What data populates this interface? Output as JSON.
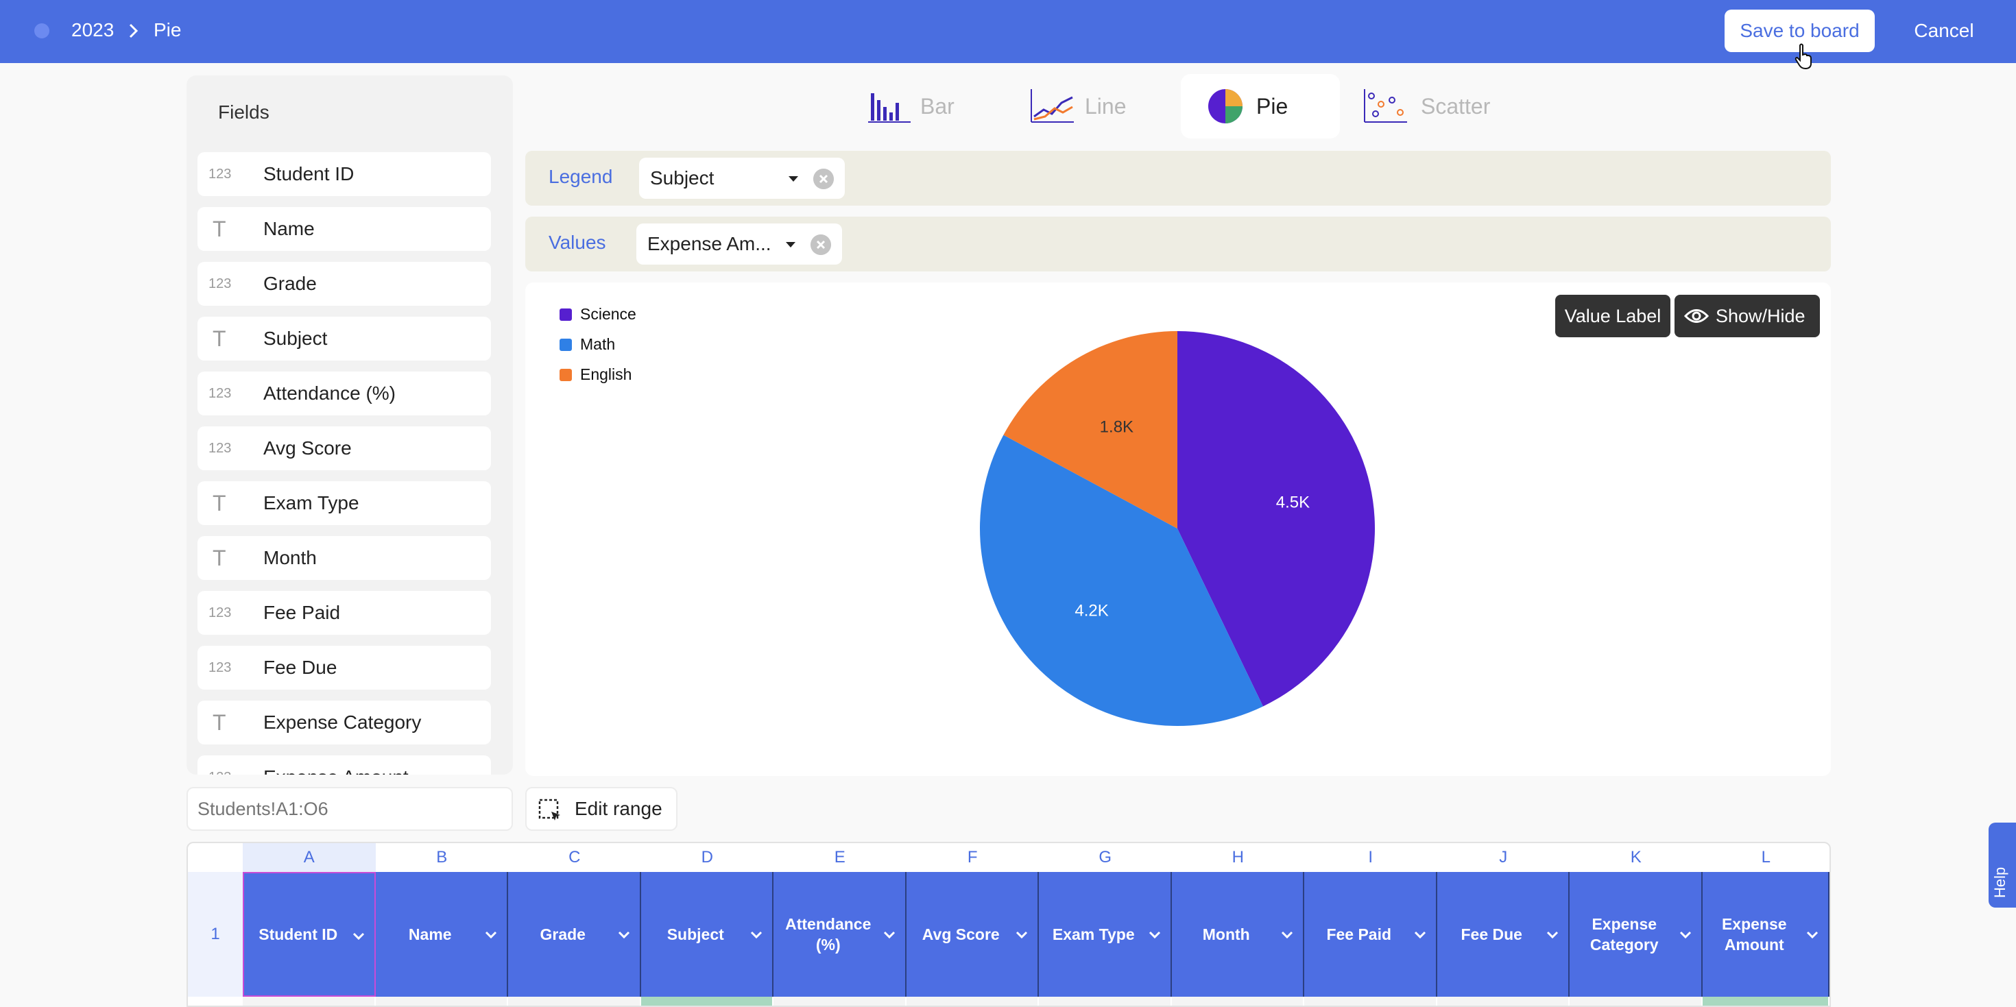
{
  "header": {
    "breadcrumb": [
      "2023",
      "Pie"
    ],
    "save_label": "Save to board",
    "cancel_label": "Cancel"
  },
  "fields_panel": {
    "title": "Fields",
    "items": [
      {
        "type": "number",
        "icon": "123",
        "label": "Student ID"
      },
      {
        "type": "text",
        "icon": "T",
        "label": "Name"
      },
      {
        "type": "number",
        "icon": "123",
        "label": "Grade"
      },
      {
        "type": "text",
        "icon": "T",
        "label": "Subject"
      },
      {
        "type": "number",
        "icon": "123",
        "label": "Attendance (%)"
      },
      {
        "type": "number",
        "icon": "123",
        "label": "Avg Score"
      },
      {
        "type": "text",
        "icon": "T",
        "label": "Exam Type"
      },
      {
        "type": "text",
        "icon": "T",
        "label": "Month"
      },
      {
        "type": "number",
        "icon": "123",
        "label": "Fee Paid"
      },
      {
        "type": "number",
        "icon": "123",
        "label": "Fee Due"
      },
      {
        "type": "text",
        "icon": "T",
        "label": "Expense Category"
      },
      {
        "type": "number",
        "icon": "123",
        "label": "Expense Amount"
      }
    ],
    "range_placeholder": "Students!A1:O6"
  },
  "chart_types": [
    {
      "id": "bar",
      "label": "Bar",
      "active": false
    },
    {
      "id": "line",
      "label": "Line",
      "active": false
    },
    {
      "id": "pie",
      "label": "Pie",
      "active": true
    },
    {
      "id": "scatter",
      "label": "Scatter",
      "active": false
    }
  ],
  "zones": {
    "legend": {
      "label": "Legend",
      "value": "Subject"
    },
    "values": {
      "label": "Values",
      "value": "Expense Am..."
    }
  },
  "chart_buttons": {
    "value_label": "Value Label",
    "show_hide": "Show/Hide"
  },
  "chart_data": {
    "type": "pie",
    "categories": [
      "Science",
      "Math",
      "English"
    ],
    "values": [
      4500,
      4200,
      1800
    ],
    "value_labels": [
      "4.5K",
      "4.2K",
      "1.8K"
    ],
    "colors": [
      "#561fcf",
      "#2f80e6",
      "#f27a2e"
    ],
    "legend_position": "top-left"
  },
  "edit_range_label": "Edit range",
  "grid": {
    "columns": [
      "A",
      "B",
      "C",
      "D",
      "E",
      "F",
      "G",
      "H",
      "I",
      "J",
      "K",
      "L"
    ],
    "row_number": "1",
    "headers": [
      "Student ID",
      "Name",
      "Grade",
      "Subject",
      "Attendance (%)",
      "Avg Score",
      "Exam Type",
      "Month",
      "Fee Paid",
      "Fee Due",
      "Expense Category",
      "Expense Amount"
    ]
  },
  "help_label": "Help"
}
